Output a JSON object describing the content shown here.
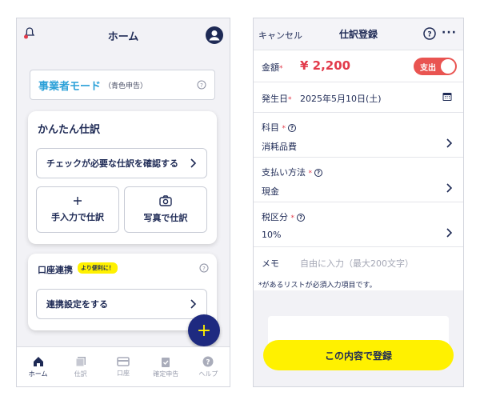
{
  "left": {
    "header": {
      "title": "ホーム"
    },
    "mode": {
      "label": "事業者モード",
      "sub": "（青色申告）"
    },
    "easy": {
      "title": "かんたん仕訳",
      "check_btn": "チェックが必要な仕訳を確認する",
      "manual_btn": "手入力で仕訳",
      "photo_btn": "写真で仕訳"
    },
    "bank": {
      "title": "口座連携",
      "badge": "より便利に！",
      "setup_btn": "連携設定をする"
    },
    "fab": "+",
    "tabs": [
      {
        "label": "ホーム",
        "icon": "home-icon"
      },
      {
        "label": "仕訳",
        "icon": "journal-icon"
      },
      {
        "label": "口座",
        "icon": "card-icon"
      },
      {
        "label": "確定申告",
        "icon": "clipboard-check-icon"
      },
      {
        "label": "ヘルプ",
        "icon": "help-icon"
      }
    ]
  },
  "right": {
    "header": {
      "cancel": "キャンセル",
      "title": "仕訳登録",
      "more": "···"
    },
    "amount": {
      "label": "金額",
      "required": "*",
      "value": "¥ 2,200",
      "toggle": "支出"
    },
    "date": {
      "label": "発生日",
      "required": "*",
      "value": "2025年5月10日(土)"
    },
    "account": {
      "label": "科目",
      "required": "*",
      "value": "消耗品費"
    },
    "payment": {
      "label": "支払い方法",
      "required": "*",
      "value": "現金"
    },
    "tax": {
      "label": "税区分",
      "required": "*",
      "value": "10%"
    },
    "memo": {
      "label": "メモ",
      "placeholder": "自由に入力（最大200文字）"
    },
    "note": "*があるリストが必須入力項目です。",
    "submit": "この内容で登録"
  },
  "colors": {
    "accent": "#1e2a80",
    "yellow": "#fff100",
    "red": "#e23a4a",
    "blue": "#2aa0d8"
  }
}
